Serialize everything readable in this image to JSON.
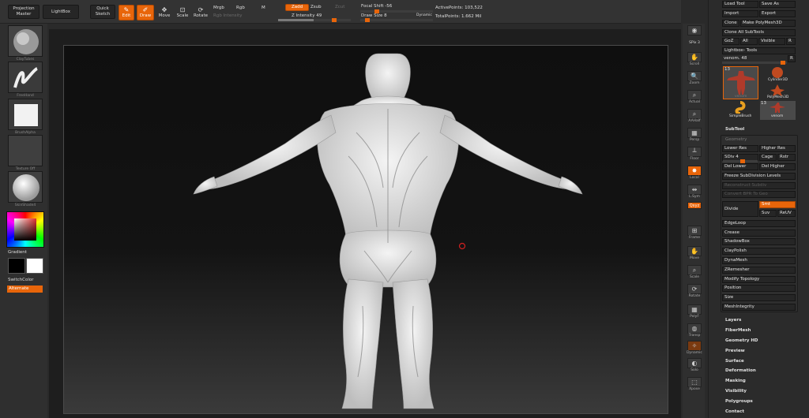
{
  "toolbar": {
    "projection_master": "Projection Master",
    "lightbox": "LightBox",
    "quick_sketch": "Quick Sketch",
    "edit": "Edit",
    "draw": "Draw",
    "move": "Move",
    "scale": "Scale",
    "rotate": "Rotate",
    "mrgb": "Mrgb",
    "rgb": "Rgb",
    "m": "M",
    "rgb_intensity": "Rgb Intensity",
    "zadd": "Zadd",
    "zsub": "Zsub",
    "zcut": "Zcut",
    "z_intensity": "Z Intensity 49",
    "focal_shift": "Focal Shift -56",
    "draw_size": "Draw Size 8",
    "dynamic": "Dynamic",
    "active_points": "ActivePoints: 103,522",
    "total_points": "TotalPoints: 1.662 Mil"
  },
  "left_shelf": {
    "brush_caption": "ClayTubes",
    "stroke_caption": "FreeHand",
    "alpha_caption": "BrushAlpha",
    "texture_caption": "Texture Off",
    "material_caption": "SkinShade4",
    "gradient": "Gradient",
    "switch_color": "SwitchColor",
    "alternate": "Alternate"
  },
  "right_tools": {
    "spix": "SPix 3",
    "scroll": "Scroll",
    "zoom": "Zoom",
    "actual": "Actual",
    "aahalf": "AAHalf",
    "persp": "Persp",
    "floor": "Floor",
    "local": "Local",
    "lsym": "L.Sym",
    "xyz": "Qxyz",
    "frame": "Frame",
    "move": "Move",
    "scale": "Scale",
    "rotate": "Rotate",
    "polyf": "PolyF",
    "transp": "Transp",
    "dynamic": "Dynamic",
    "solo": "Solo",
    "xpose": "Xpose"
  },
  "palette": {
    "load_tool": "Load Tool",
    "save_as": "Save As",
    "import": "Import",
    "export": "Export",
    "clone": "Clone",
    "make_polymesh": "Make PolyMesh3D",
    "clone_all": "Clone All SubTools",
    "goz": "GoZ",
    "all": "All",
    "visible": "Visible",
    "r": "R",
    "lightbox_tools": "Lightbox› Tools",
    "tool_name": "venom. 48",
    "r2": "R",
    "thumb_count_1": "13",
    "thumb_count_2": "13",
    "thumb_venom": "venom",
    "cylinder": "Cylinder3D",
    "polymesh": "PolyMesh3D",
    "simplebrush": "SimpleBrush",
    "venom": "venom",
    "subtool": "SubTool",
    "geometry": "Geometry",
    "lower_res": "Lower Res",
    "higher_res": "Higher Res",
    "sdiv": "SDiv 4",
    "cage": "Cage",
    "rstr": "Rstr",
    "del_lower": "Del Lower",
    "del_higher": "Del Higher",
    "freeze": "Freeze SubDivision Levels",
    "reconstruct": "Reconstruct Subdiv",
    "convert_bpr": "Convert BPR To Geo",
    "divide": "Divide",
    "smt": "Smt",
    "suv": "Suv",
    "reuv": "ReUV",
    "edgeloop": "EdgeLoop",
    "crease": "Crease",
    "shadowbox": "ShadowBox",
    "claypolish": "ClayPolish",
    "dynamesh": "DynaMesh",
    "zremesher": "ZRemesher",
    "modify_topology": "Modify Topology",
    "position": "Position",
    "size": "Size",
    "meshintegrity": "MeshIntegrity",
    "layers": "Layers",
    "fibermesh": "FiberMesh",
    "geometry_hd": "Geometry HD",
    "preview": "Preview",
    "surface": "Surface",
    "deformation": "Deformation",
    "masking": "Masking",
    "visibility": "Visibility",
    "polygroups": "Polygroups",
    "contact": "Contact"
  },
  "colors": {
    "accent": "#e8650a",
    "mesh": "#ececec",
    "background": "#2a2a2a"
  }
}
